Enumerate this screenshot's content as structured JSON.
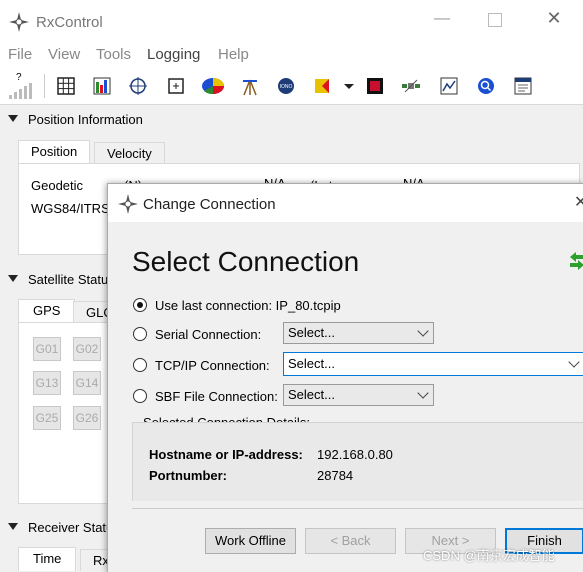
{
  "window": {
    "title": "RxControl"
  },
  "menu": {
    "items": [
      "File",
      "View",
      "Tools",
      "Logging",
      "Help"
    ]
  },
  "toolbar": {
    "icons": [
      "signal-strength-icon",
      "grid-icon",
      "color-bars-icon",
      "crosshair-icon",
      "plus-box-icon",
      "pie-chart-icon",
      "antenna-icon",
      "hdop-icon",
      "triangle-flag-icon",
      "dropdown-arrow-icon",
      "record-icon",
      "satellite-icon",
      "plot-icon",
      "search-icon",
      "log-window-icon"
    ],
    "signal_label": "?"
  },
  "position": {
    "title": "Position Information",
    "tabs": [
      "Position",
      "Velocity"
    ],
    "rows": [
      {
        "label": "Geodetic",
        "v1": "(N)",
        "v2": "N/A",
        "v3": "(Lat.",
        "v4": "N/A"
      },
      {
        "label": "WGS84/ITRS"
      }
    ]
  },
  "satellite": {
    "title": "Satellite Status",
    "tabs": [
      "GPS",
      "GLO"
    ],
    "buttons": [
      "G01",
      "G02",
      "G13",
      "G14",
      "G25",
      "G26"
    ]
  },
  "receiver": {
    "title": "Receiver Status",
    "tabs": [
      "Time",
      "Rx"
    ]
  },
  "dialog": {
    "title": "Change Connection",
    "heading": "Select Connection",
    "options": [
      {
        "label": "Use last connection: IP_80.tcpip",
        "selected": true
      },
      {
        "label": "Serial Connection:",
        "selected": false,
        "combo": "Select..."
      },
      {
        "label": "TCP/IP Connection:",
        "selected": false,
        "combo": "Select..."
      },
      {
        "label": "SBF File Connection:",
        "selected": false,
        "combo": "Select..."
      }
    ],
    "details": {
      "title": "Selected Connection Details:",
      "hostname_label": "Hostname or IP-address:",
      "hostname_value": "192.168.0.80",
      "port_label": "Portnumber:",
      "port_value": "28784"
    },
    "buttons": {
      "work_offline": "Work Offline",
      "back": "< Back",
      "next": "Next >",
      "finish": "Finish"
    }
  },
  "watermark": "CSDN @南京宏成智能"
}
